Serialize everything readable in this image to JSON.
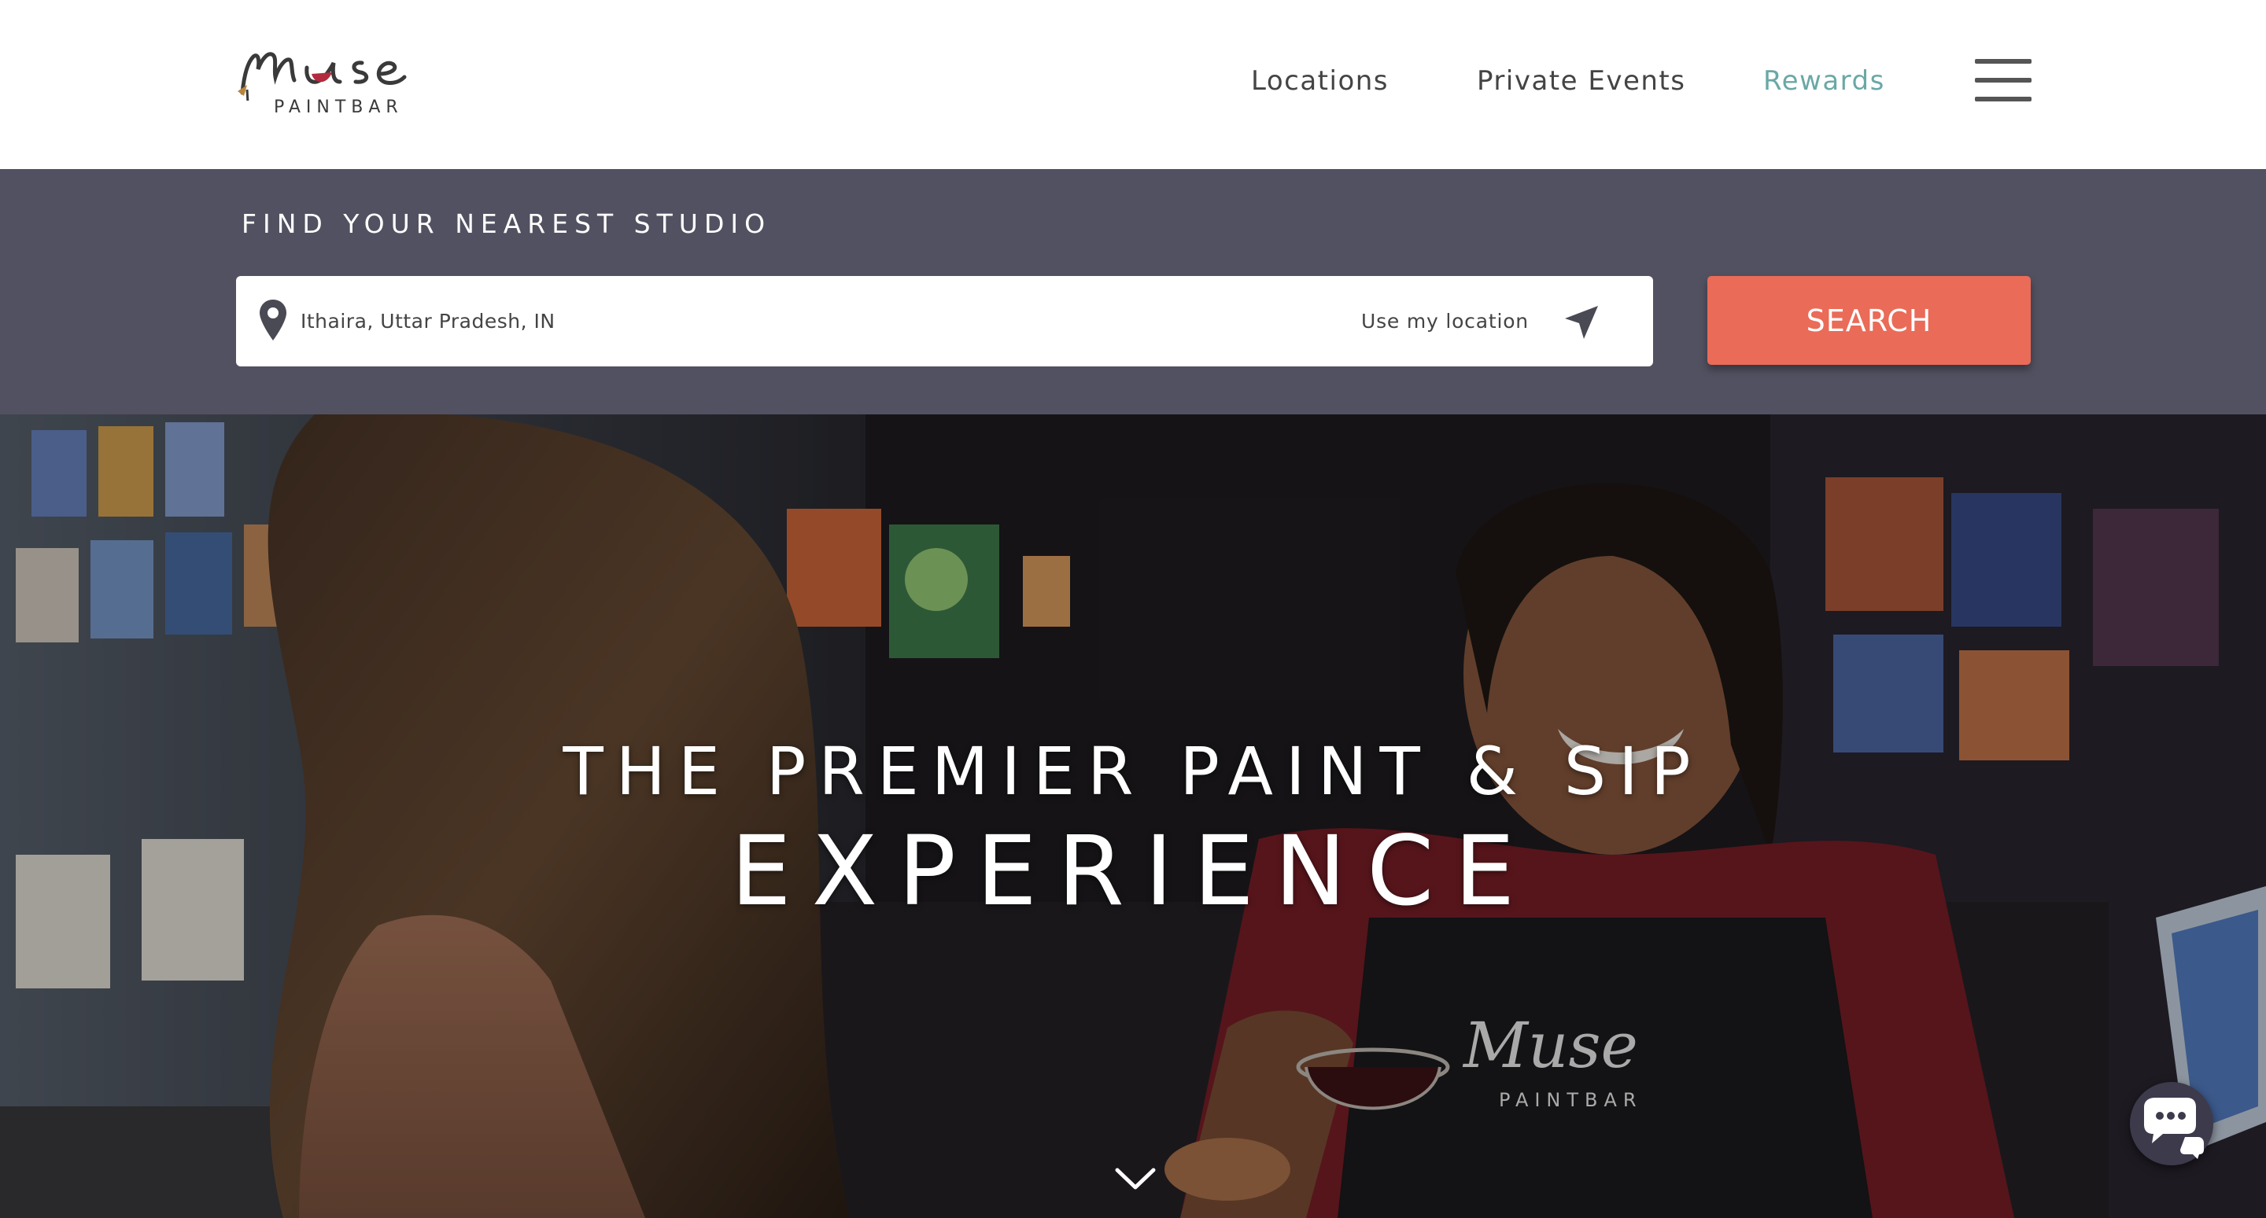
{
  "header": {
    "logo": {
      "wordmark": "Muse",
      "subtitle": "PAINTBAR"
    },
    "nav": {
      "locations": "Locations",
      "private_events": "Private Events",
      "rewards": "Rewards"
    },
    "menu_icon": "hamburger-icon"
  },
  "search": {
    "title": "FIND YOUR NEAREST STUDIO",
    "location_value": "Ithaira, Uttar Pradesh, IN",
    "pin_icon": "map-pin-icon",
    "use_location_label": "Use my location",
    "use_location_icon": "navigation-arrow-icon",
    "button_label": "SEARCH"
  },
  "hero": {
    "line1": "THE PREMIER PAINT & SIP",
    "line2": "EXPERIENCE",
    "scroll_icon": "chevron-down-icon",
    "chat_icon": "chat-bubbles-icon"
  },
  "colors": {
    "nav_text": "#444444",
    "rewards_accent": "#6aa8a6",
    "search_band": "#525161",
    "search_button": "#ea6b57",
    "logo_accent": "#b22a3e"
  }
}
